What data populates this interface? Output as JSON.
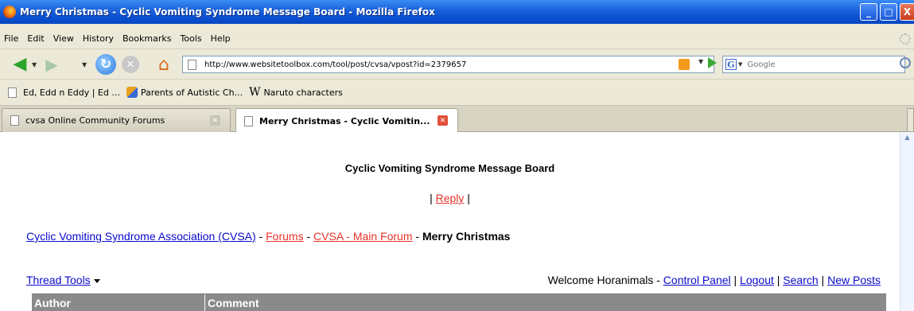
{
  "window": {
    "title": "Merry Christmas - Cyclic Vomiting Syndrome Message Board - Mozilla Firefox",
    "buttons": {
      "minimize": "_",
      "maximize": "□",
      "close": "X"
    }
  },
  "menubar": {
    "items": [
      "File",
      "Edit",
      "View",
      "History",
      "Bookmarks",
      "Tools",
      "Help"
    ]
  },
  "navbar": {
    "url": "http://www.websitetoolbox.com/tool/post/cvsa/vpost?id=2379657",
    "search_placeholder": "Google"
  },
  "bookmarks": [
    {
      "label": "Ed, Edd n Eddy | Ed ...",
      "icon": "page-icon"
    },
    {
      "label": "Parents of Autistic Ch...",
      "icon": "people-icon"
    },
    {
      "label": "Naruto characters",
      "icon": "wikipedia-icon"
    }
  ],
  "tabs": [
    {
      "label": "cvsa Online Community Forums",
      "active": false
    },
    {
      "label": "Merry Christmas - Cyclic Vomitin...",
      "active": true
    }
  ],
  "page": {
    "board_title": "Cyclic Vomiting Syndrome Message Board",
    "reply_prefix": "| ",
    "reply_label": "Reply",
    "reply_suffix": " |",
    "breadcrumb": {
      "home": "Cyclic Vomiting Syndrome Association (CVSA)",
      "sep1": " - ",
      "forums": "Forums",
      "sep2": " - ",
      "main_forum": "CVSA - Main Forum",
      "sep3": " - ",
      "current": "Merry Christmas"
    },
    "thread_tools": "Thread Tools",
    "welcome": "Welcome Horanimals - ",
    "control_panel": "Control Panel",
    "sep_a": " | ",
    "logout": "Logout",
    "sep_b": " | ",
    "search": "Search",
    "sep_c": " | ",
    "new_posts": "New Posts",
    "table_headers": [
      "Author",
      "Comment"
    ]
  },
  "colors": {
    "link_blue": "#0a0acc",
    "link_red": "#e8322a",
    "table_header": "#8a8a8a"
  }
}
